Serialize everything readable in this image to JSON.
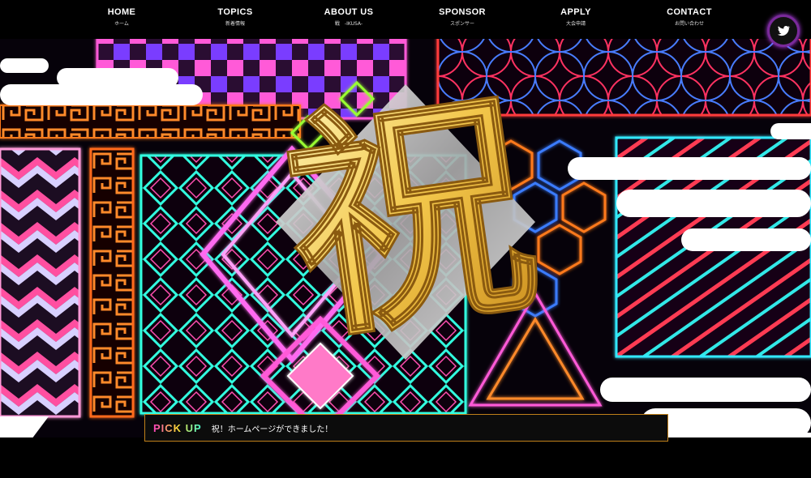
{
  "nav": {
    "items": [
      {
        "label": "HOME",
        "sub": "ホーム"
      },
      {
        "label": "TOPICS",
        "sub": "新着情報"
      },
      {
        "label": "ABOUT US",
        "sub": "戦　-IKUSA-"
      },
      {
        "label": "SPONSOR",
        "sub": "スポンサー"
      },
      {
        "label": "APPLY",
        "sub": "大会申請"
      },
      {
        "label": "CONTACT",
        "sub": "お問い合わせ"
      }
    ]
  },
  "social": {
    "icon": "twitter-icon"
  },
  "hero": {
    "glyph": "祝"
  },
  "pickup": {
    "label": "PICK UP",
    "text": "祝！ホームページができました！"
  },
  "colors": {
    "accent_border": "#c0801a",
    "neon_pink": "#ff3cc8",
    "neon_cyan": "#33ffe0",
    "neon_orange": "#ff6a1a",
    "gold": "#f2c64a"
  }
}
